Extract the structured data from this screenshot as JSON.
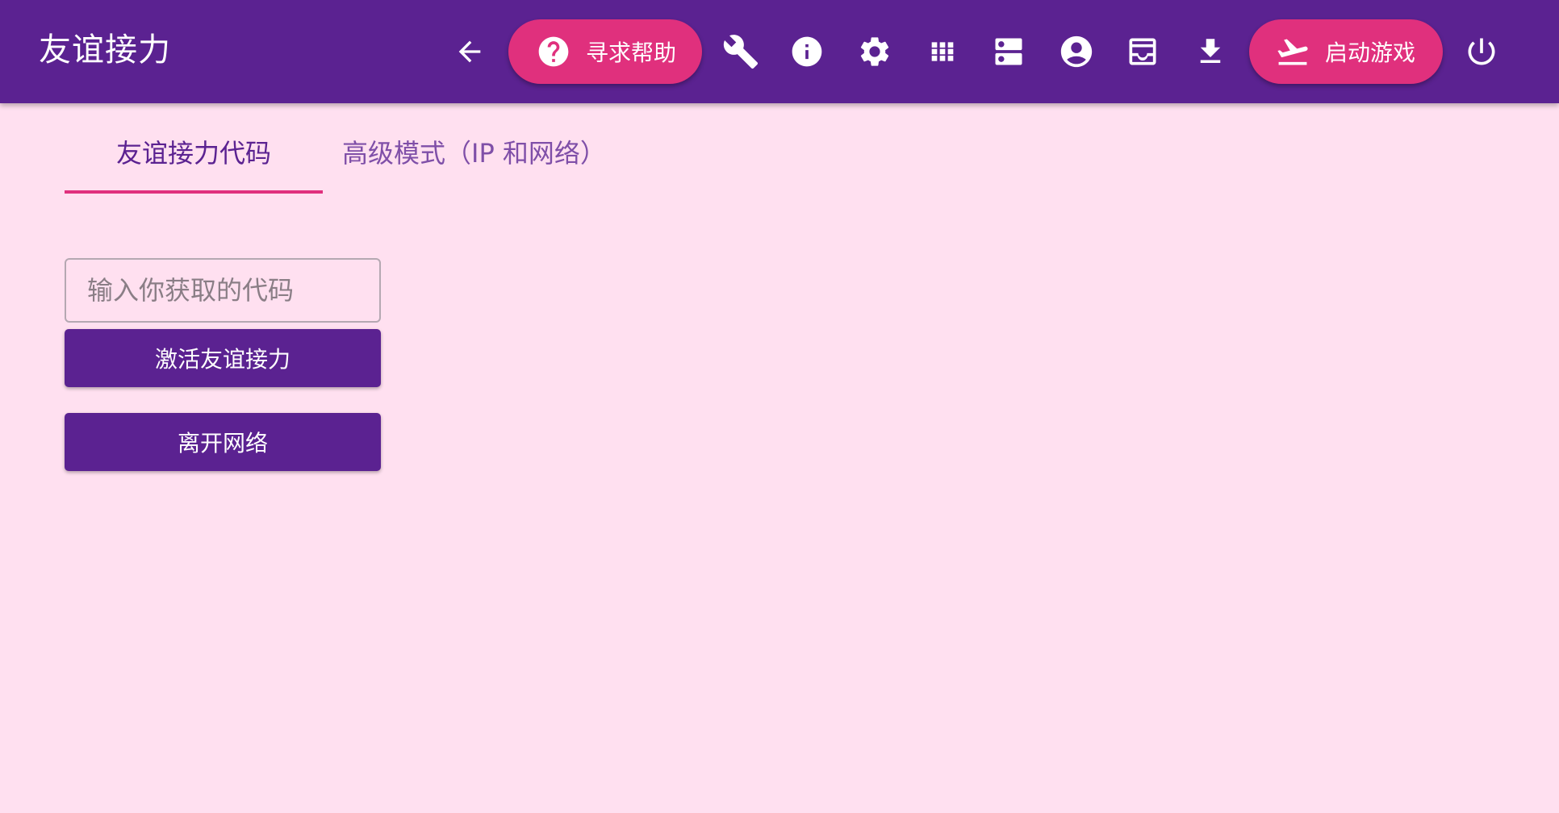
{
  "app": {
    "title": "友谊接力"
  },
  "toolbar": {
    "back_icon": "arrow-left-icon",
    "help_button": {
      "label": "寻求帮助",
      "icon": "help-circle-icon"
    },
    "icons": [
      "wrench-icon",
      "info-icon",
      "gear-icon",
      "apps-grid-icon",
      "server-icon",
      "account-circle-icon",
      "inbox-icon",
      "download-icon"
    ],
    "launch_button": {
      "label": "启动游戏",
      "icon": "airplane-takeoff-icon"
    },
    "power_icon": "power-icon"
  },
  "tabs": [
    {
      "label": "友谊接力代码",
      "active": true
    },
    {
      "label": "高级模式（IP 和网络）",
      "active": false
    }
  ],
  "form": {
    "code_input": {
      "value": "",
      "placeholder": "输入你获取的代码"
    },
    "activate_label": "激活友谊接力",
    "leave_label": "离开网络"
  },
  "colors": {
    "appbar": "#5b2291",
    "accent": "#e0307d",
    "background": "#ffe0f0",
    "primary_button": "#5b2291"
  }
}
